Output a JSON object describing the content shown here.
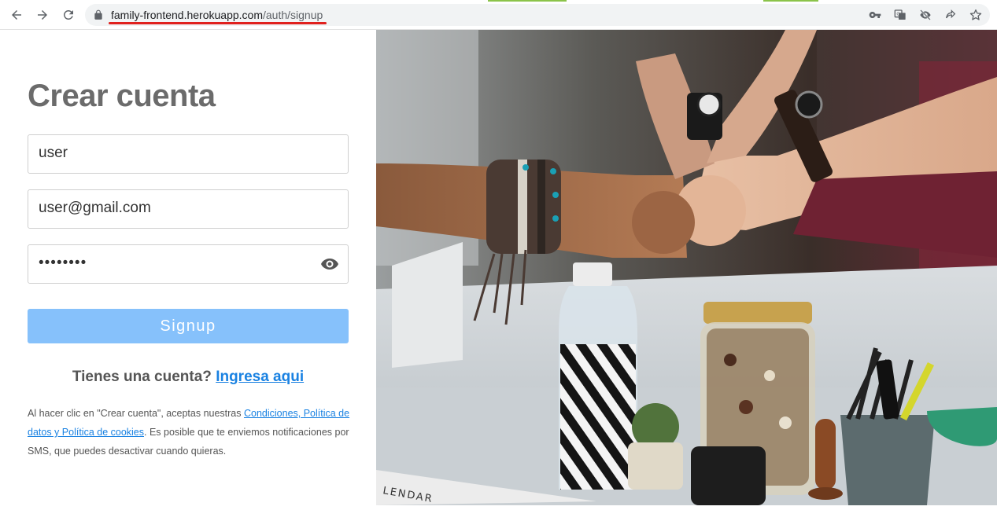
{
  "browser": {
    "url_host": "family-frontend.herokuapp.com",
    "url_path": "/auth/signup"
  },
  "form": {
    "title": "Crear cuenta",
    "username_value": "user",
    "email_value": "user@gmail.com",
    "password_value": "••••••••",
    "signup_label": "Signup",
    "have_account_text": "Tienes una cuenta?",
    "login_link": "Ingresa aqui",
    "legal_prefix": "Al hacer clic en \"Crear cuenta\", aceptas nuestras ",
    "legal_link": "Condiciones, Política de datos y Política de cookies",
    "legal_suffix": ". Es posible que te enviemos notificaciones por SMS, que puedes desactivar cuando quieras."
  },
  "photo": {
    "calendar_text": "LENDAR"
  },
  "colors": {
    "title": "#6b6b6b",
    "button": "#86c1fb",
    "link": "#1a82e2",
    "url_underline": "#e0201d"
  },
  "icons": [
    "back-icon",
    "forward-icon",
    "reload-icon",
    "lock-icon",
    "key-icon",
    "translate-icon",
    "eye-off-icon",
    "share-icon",
    "star-icon",
    "eye-icon"
  ]
}
